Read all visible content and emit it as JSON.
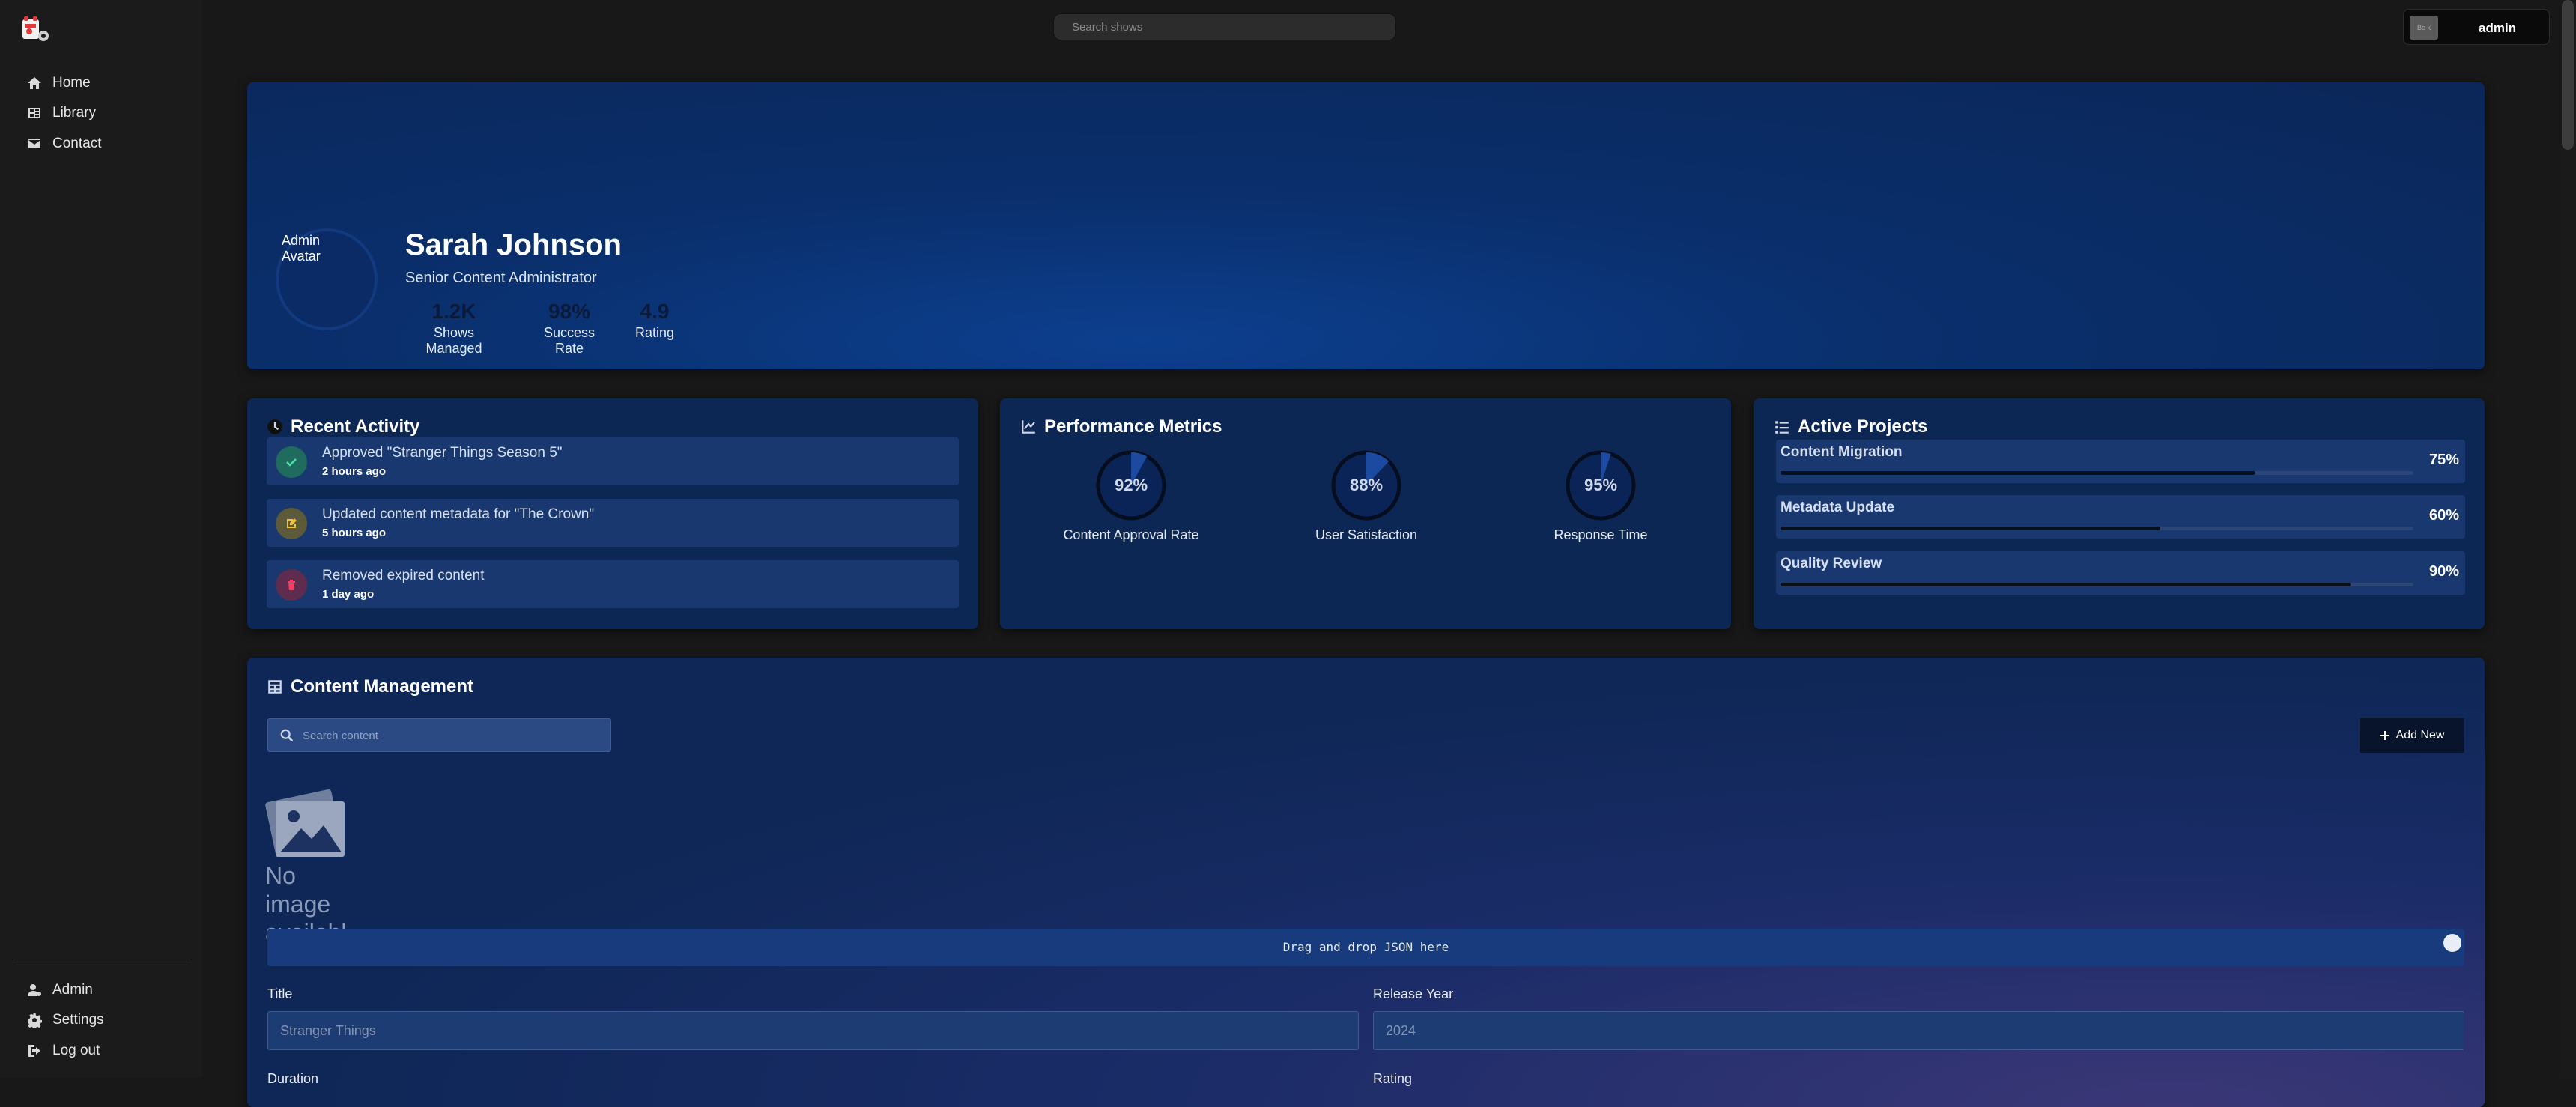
{
  "search": {
    "placeholder": "Search shows"
  },
  "user": {
    "name": "admin",
    "avatar_alt": "Bo k"
  },
  "sidebar": {
    "items": [
      {
        "label": "Home",
        "icon": "home-icon"
      },
      {
        "label": "Library",
        "icon": "library-icon"
      },
      {
        "label": "Contact",
        "icon": "envelope-icon"
      }
    ],
    "bottom_items": [
      {
        "label": "Admin",
        "icon": "user-gear-icon"
      },
      {
        "label": "Settings",
        "icon": "gear-icon"
      },
      {
        "label": "Log out",
        "icon": "logout-icon"
      }
    ]
  },
  "profile": {
    "avatar_alt": "Admin Avatar",
    "name": "Sarah Johnson",
    "role": "Senior Content Administrator",
    "stats": [
      {
        "value": "1.2K",
        "label": "Shows Managed"
      },
      {
        "value": "98%",
        "label": "Success Rate"
      },
      {
        "value": "4.9",
        "label": "Rating"
      }
    ]
  },
  "recent_activity": {
    "title": "Recent Activity",
    "items": [
      {
        "text": "Approved \"Stranger Things Season 5\"",
        "time": "2 hours ago",
        "icon": "check-icon",
        "color": "#2fae80"
      },
      {
        "text": "Updated content metadata for \"The Crown\"",
        "time": "5 hours ago",
        "icon": "edit-icon",
        "color": "#e0b23a"
      },
      {
        "text": "Removed expired content",
        "time": "1 day ago",
        "icon": "trash-icon",
        "color": "#e0355a"
      }
    ]
  },
  "performance": {
    "title": "Performance Metrics",
    "metrics": [
      {
        "value": "92%",
        "fraction": 0.08,
        "label": "Content Approval Rate"
      },
      {
        "value": "88%",
        "fraction": 0.12,
        "label": "User Satisfaction"
      },
      {
        "value": "95%",
        "fraction": 0.05,
        "label": "Response Time"
      }
    ]
  },
  "projects": {
    "title": "Active Projects",
    "items": [
      {
        "name": "Content Migration",
        "value": "75%",
        "progress": 0.75
      },
      {
        "name": "Metadata Update",
        "value": "60%",
        "progress": 0.6
      },
      {
        "name": "Quality Review",
        "value": "90%",
        "progress": 0.9
      }
    ]
  },
  "content_management": {
    "title": "Content Management",
    "search_placeholder": "Search content",
    "add_label": "Add New",
    "no_image": "No image available",
    "dropzone": "Drag and drop JSON here",
    "fields": [
      {
        "label": "Title",
        "placeholder": "Stranger Things"
      },
      {
        "label": "Release Year",
        "placeholder": "2024"
      },
      {
        "label": "Duration"
      },
      {
        "label": "Rating"
      }
    ]
  }
}
